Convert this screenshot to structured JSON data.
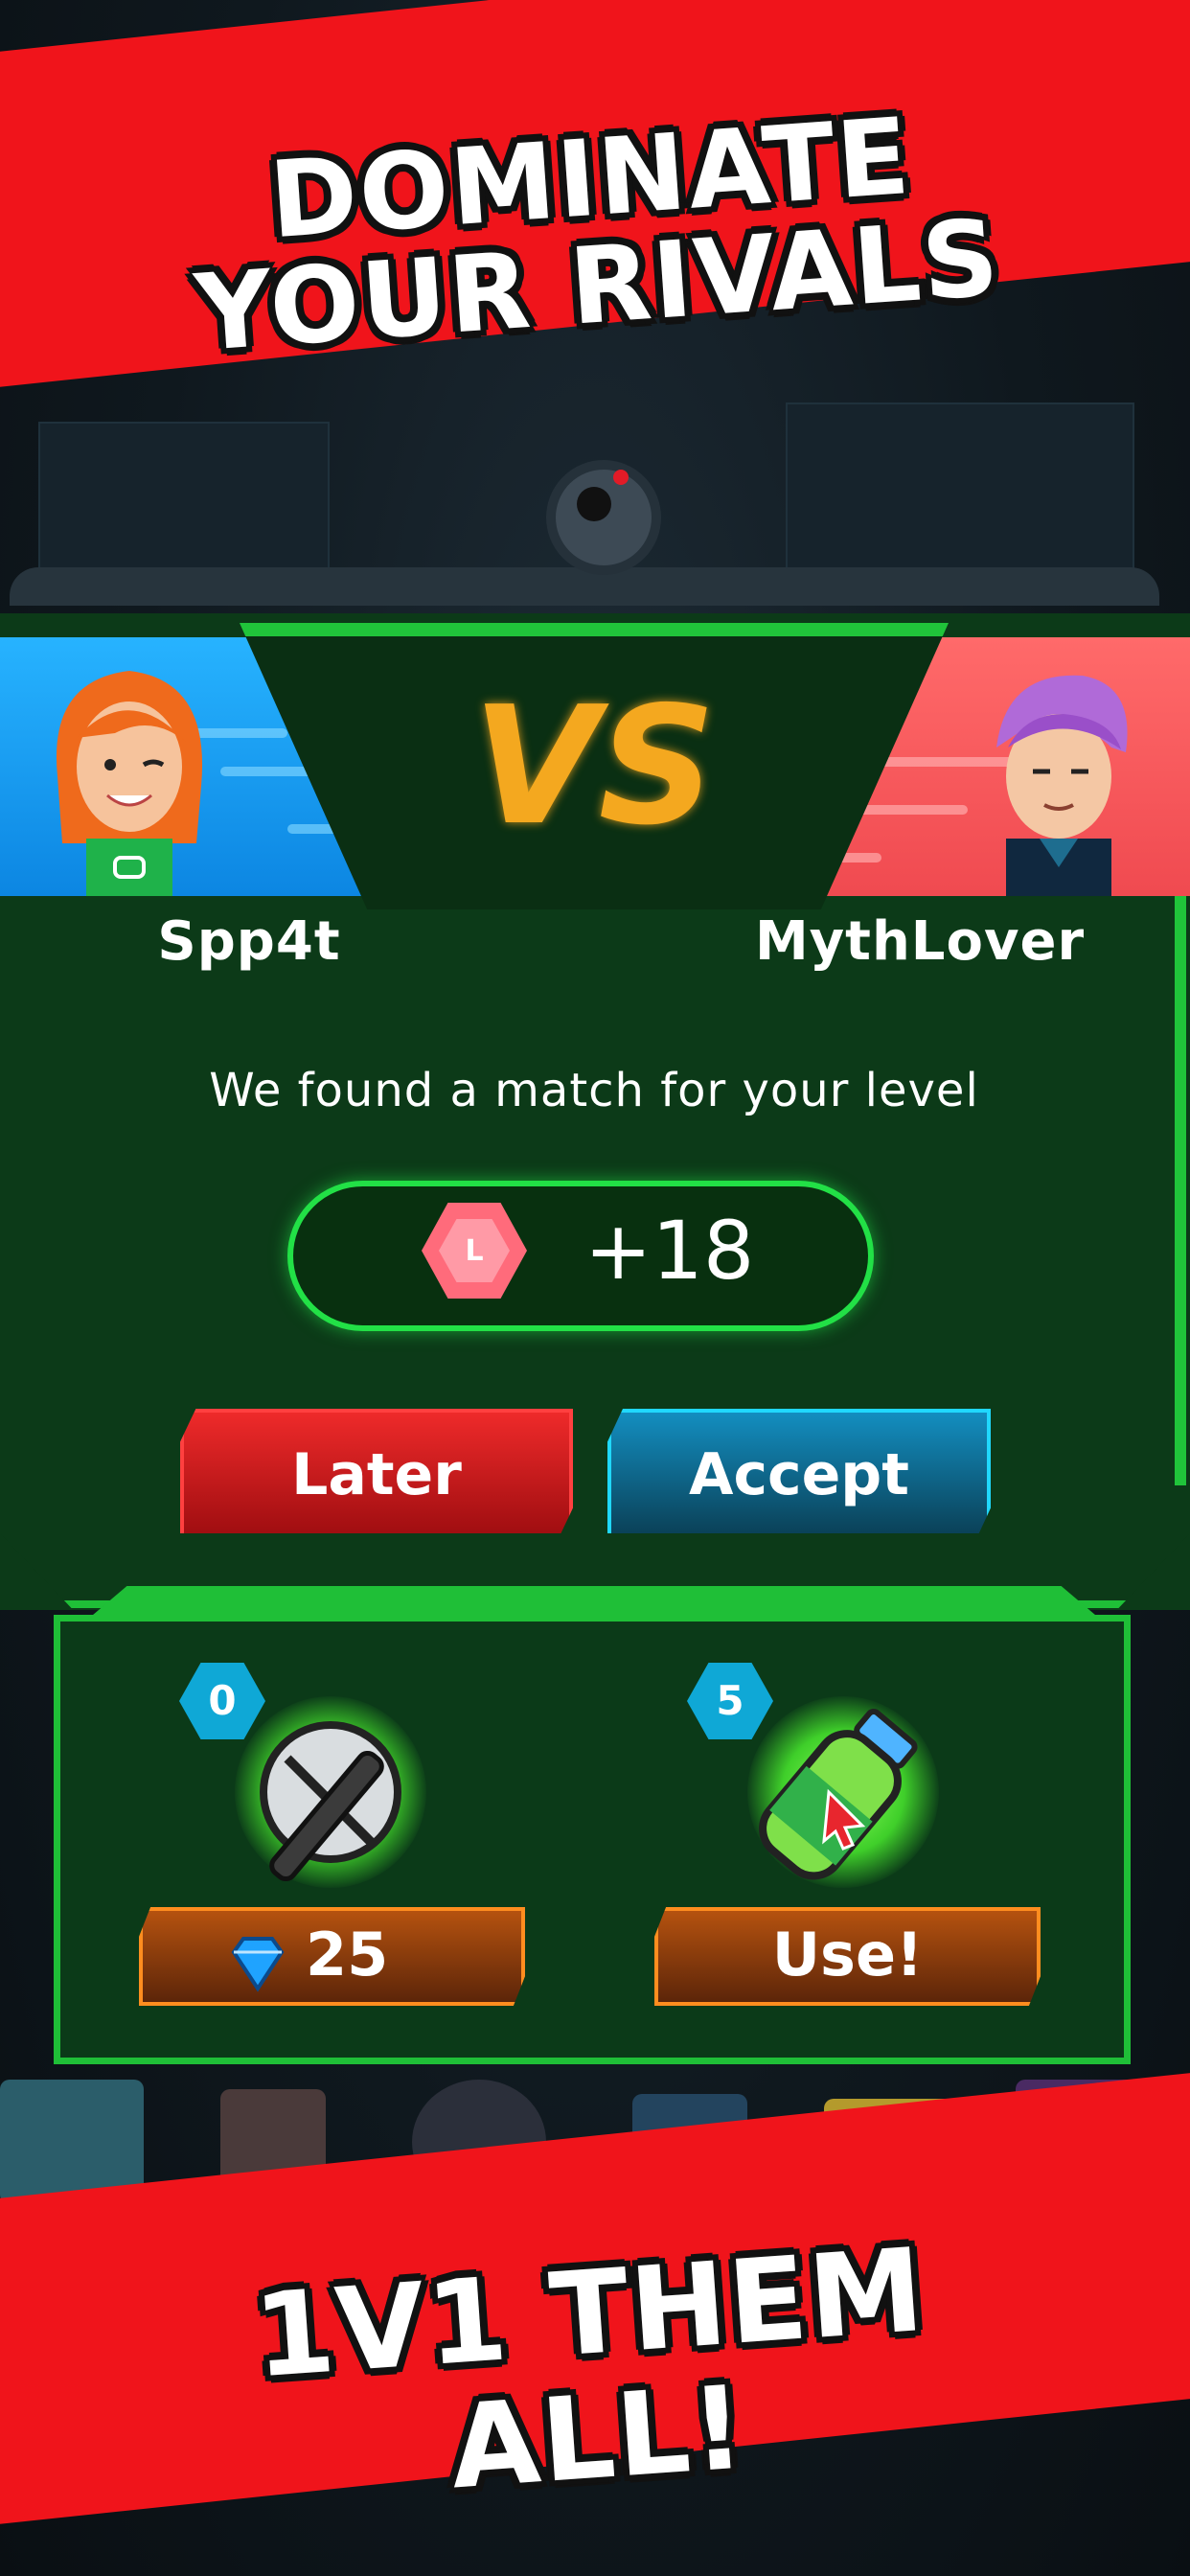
{
  "headline_top": "DOMINATE YOUR RIVALS",
  "headline_bottom": "1V1 THEM ALL!",
  "match": {
    "vs_label": "VS",
    "player_left_name": "Spp4t",
    "player_right_name": "MythLover",
    "status_text": "We found a match for your level",
    "reward_badge_letter": "L",
    "reward_value": "+18",
    "later_label": "Later",
    "accept_label": "Accept"
  },
  "items": [
    {
      "icon": "axe-icon",
      "count": "0",
      "action_label": "25",
      "action_icon": "gem-icon"
    },
    {
      "icon": "energy-drink-icon",
      "count": "5",
      "action_label": "Use!"
    }
  ],
  "colors": {
    "banner_red": "#f0141b",
    "accent_green": "#1fbf37",
    "vs_orange": "#f4a81f",
    "later_red": "#e02020",
    "accept_cyan": "#20d8ff",
    "player_left_blue": "#27b3ff",
    "player_right_red": "#f04a50"
  }
}
